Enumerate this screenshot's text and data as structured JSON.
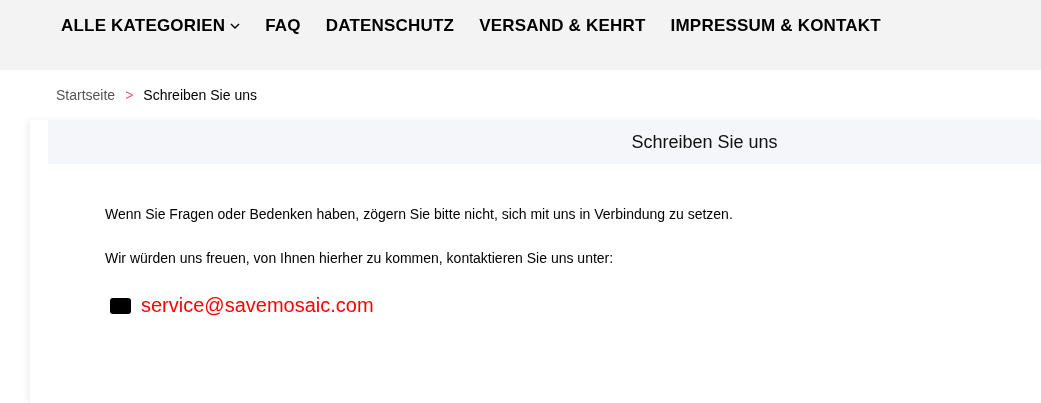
{
  "nav": {
    "items": [
      {
        "label": "ALLE KATEGORIEN",
        "dropdown": true
      },
      {
        "label": "FAQ",
        "dropdown": false
      },
      {
        "label": "DATENSCHUTZ",
        "dropdown": false
      },
      {
        "label": "VERSAND & KEHRT",
        "dropdown": false
      },
      {
        "label": "IMPRESSUM & KONTAKT",
        "dropdown": false
      }
    ]
  },
  "breadcrumb": {
    "items": [
      "Startseite",
      "Schreiben Sie uns"
    ],
    "separator": ">"
  },
  "card": {
    "title": "Schreiben Sie uns",
    "paragraphs": [
      "Wenn Sie Fragen oder Bedenken haben, zögern Sie bitte nicht, sich mit uns in Verbindung zu setzen.",
      "Wir würden uns freuen, von Ihnen hierher zu kommen, kontaktieren Sie uns unter:"
    ],
    "email": "service@savemosaic.com"
  }
}
